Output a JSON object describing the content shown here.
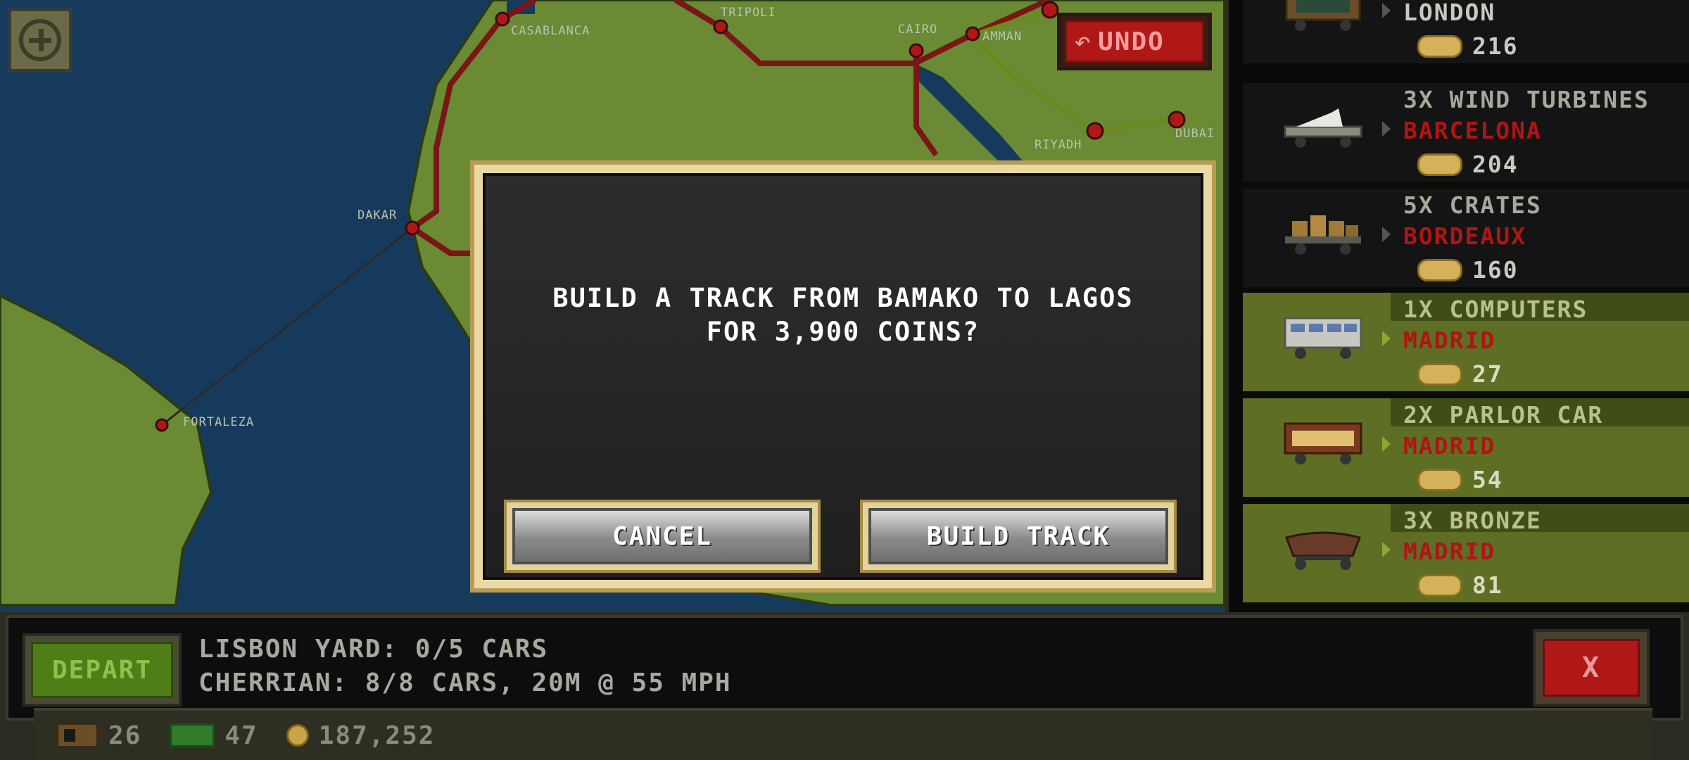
{
  "map": {
    "cities": [
      "CASABLANCA",
      "TRIPOLI",
      "CAIRO",
      "AMMAN",
      "DAKAR",
      "RIYADH",
      "DUBAI",
      "FORTALEZA"
    ],
    "zoom_icon": "zoom-plus-icon",
    "undo_label": "UNDO",
    "colors": {
      "ocean": "#163a5c",
      "land": "#6a8a34",
      "track": "#7a1616",
      "track_green": "#6d8a1f"
    }
  },
  "cargo": [
    {
      "title": "",
      "dest": "LONDON",
      "dest_color": "#c9c9c0",
      "amount": "216",
      "highlight": false,
      "car": "boxcar"
    },
    {
      "title": "3X WIND TURBINES",
      "dest": "BARCELONA",
      "dest_color": "#b01414",
      "amount": "204",
      "highlight": false,
      "car": "flatcar"
    },
    {
      "title": "5X CRATES",
      "dest": "BORDEAUX",
      "dest_color": "#b01414",
      "amount": "160",
      "highlight": false,
      "car": "crates"
    },
    {
      "title": "1X COMPUTERS",
      "dest": "MADRID",
      "dest_color": "#b01414",
      "amount": "27",
      "highlight": true,
      "car": "container"
    },
    {
      "title": "2X PARLOR CAR",
      "dest": "MADRID",
      "dest_color": "#b01414",
      "amount": "54",
      "highlight": true,
      "car": "parlor"
    },
    {
      "title": "3X BRONZE",
      "dest": "MADRID",
      "dest_color": "#b01414",
      "amount": "81",
      "highlight": true,
      "car": "hopper"
    }
  ],
  "dialog": {
    "line1": "BUILD A TRACK FROM BAMAKO TO LAGOS",
    "line2": "FOR 3,900 COINS?",
    "cancel_label": "CANCEL",
    "confirm_label": "BUILD TRACK"
  },
  "bottom": {
    "depart_label": "DEPART",
    "yard_line": "LISBON YARD: 0/5 CARS",
    "train_line": "CHERRIAN: 8/8 CARS, 20M @ 55 MPH",
    "close_label": "X",
    "stats": {
      "cars": "26",
      "cash": "47",
      "coins": "187,252"
    }
  }
}
